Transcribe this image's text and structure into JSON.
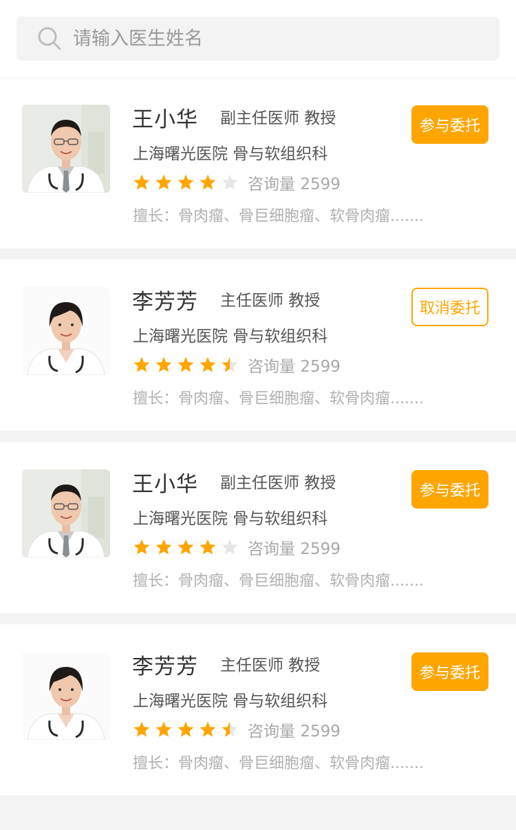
{
  "search": {
    "placeholder": "请输入医生姓名",
    "icon": "search-icon"
  },
  "colors": {
    "accent": "#ffa500",
    "star_empty": "#e6e6e6",
    "text_primary": "#333333",
    "text_secondary": "#555555",
    "text_muted": "#a8a8a8"
  },
  "doctors": [
    {
      "name": "王小华",
      "title": "副主任医师 教授",
      "hospital": "上海曙光医院 骨与软组织科",
      "rating": 4,
      "consult_label": "咨询量",
      "consult_count": "2599",
      "specialty": "擅长：骨肉瘤、骨巨细胞瘤、软骨肉瘤.......",
      "action": {
        "label": "参与委托",
        "style": "filled"
      },
      "avatar": "male-doctor"
    },
    {
      "name": "李芳芳",
      "title": "主任医师 教授",
      "hospital": "上海曙光医院 骨与软组织科",
      "rating": 4.5,
      "consult_label": "咨询量",
      "consult_count": "2599",
      "specialty": "擅长：骨肉瘤、骨巨细胞瘤、软骨肉瘤.......",
      "action": {
        "label": "取消委托",
        "style": "outline"
      },
      "avatar": "female-doctor"
    },
    {
      "name": "王小华",
      "title": "副主任医师 教授",
      "hospital": "上海曙光医院 骨与软组织科",
      "rating": 4,
      "consult_label": "咨询量",
      "consult_count": "2599",
      "specialty": "擅长：骨肉瘤、骨巨细胞瘤、软骨肉瘤.......",
      "action": {
        "label": "参与委托",
        "style": "filled"
      },
      "avatar": "male-doctor"
    },
    {
      "name": "李芳芳",
      "title": "主任医师 教授",
      "hospital": "上海曙光医院 骨与软组织科",
      "rating": 4.5,
      "consult_label": "咨询量",
      "consult_count": "2599",
      "specialty": "擅长：骨肉瘤、骨巨细胞瘤、软骨肉瘤.......",
      "action": {
        "label": "参与委托",
        "style": "filled"
      },
      "avatar": "female-doctor"
    }
  ]
}
